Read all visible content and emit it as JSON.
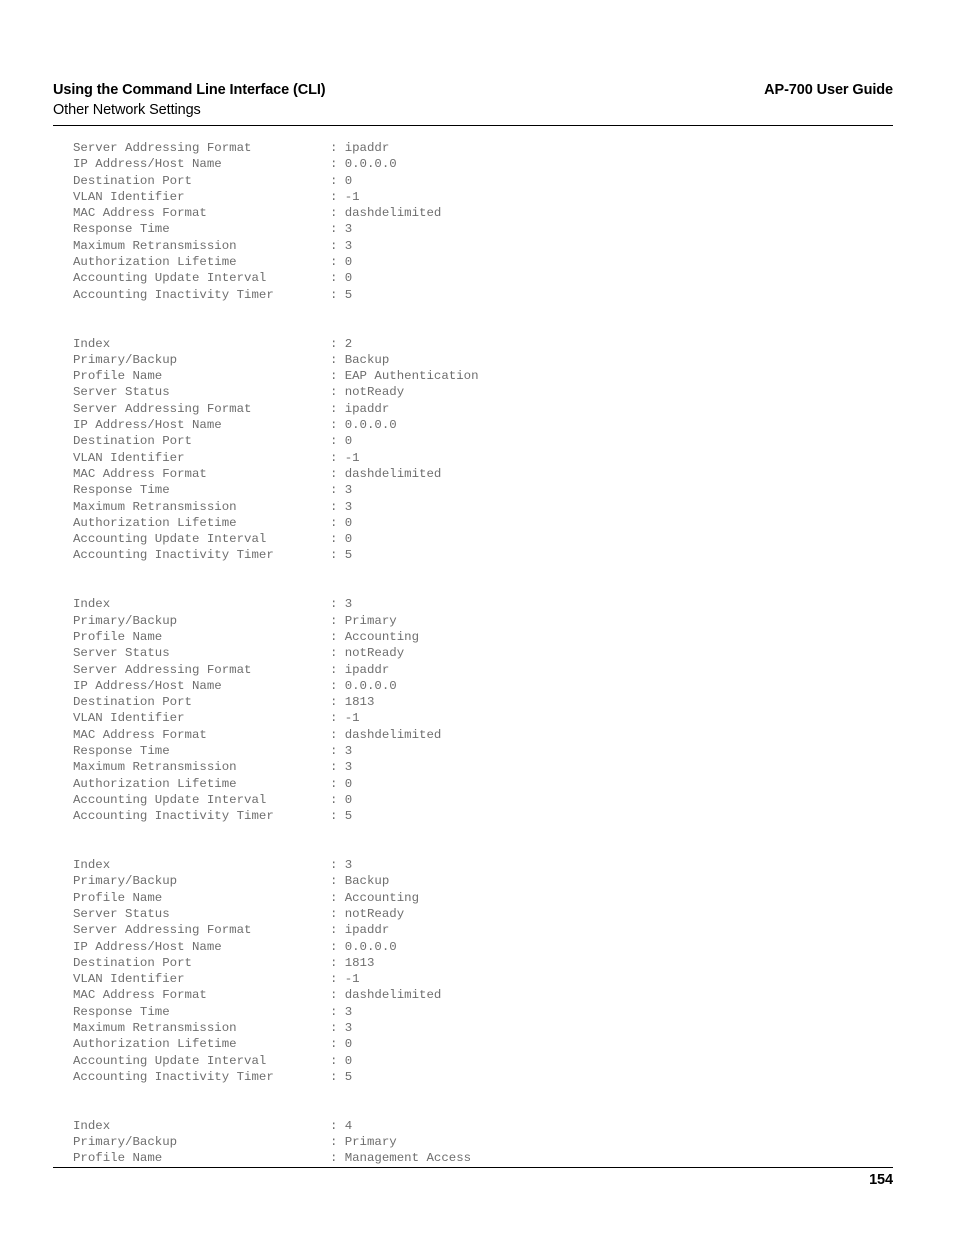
{
  "document": {
    "header": {
      "section_title": "Using the Command Line Interface (CLI)",
      "guide_title": "AP-700 User Guide",
      "subsection_title": "Other Network Settings"
    },
    "footer": {
      "page_number": "154"
    }
  },
  "cli_output": {
    "separator": ":",
    "blocks": [
      {
        "id": "radius-server-record-continued",
        "rows": [
          {
            "label": "Server Addressing Format",
            "value": "ipaddr"
          },
          {
            "label": "IP Address/Host Name",
            "value": "0.0.0.0"
          },
          {
            "label": "Destination Port",
            "value": "0"
          },
          {
            "label": "VLAN Identifier",
            "value": "-1"
          },
          {
            "label": "MAC Address Format",
            "value": "dashdelimited"
          },
          {
            "label": "Response Time",
            "value": "3"
          },
          {
            "label": "Maximum Retransmission",
            "value": "3"
          },
          {
            "label": "Authorization Lifetime",
            "value": "0"
          },
          {
            "label": "Accounting Update Interval",
            "value": "0"
          },
          {
            "label": "Accounting Inactivity Timer",
            "value": "5"
          }
        ]
      },
      {
        "id": "radius-server-record-index-2",
        "rows": [
          {
            "label": "Index",
            "value": "2"
          },
          {
            "label": "Primary/Backup",
            "value": "Backup"
          },
          {
            "label": "Profile Name",
            "value": "EAP Authentication"
          },
          {
            "label": "Server Status",
            "value": "notReady"
          },
          {
            "label": "Server Addressing Format",
            "value": "ipaddr"
          },
          {
            "label": "IP Address/Host Name",
            "value": "0.0.0.0"
          },
          {
            "label": "Destination Port",
            "value": "0"
          },
          {
            "label": "VLAN Identifier",
            "value": "-1"
          },
          {
            "label": "MAC Address Format",
            "value": "dashdelimited"
          },
          {
            "label": "Response Time",
            "value": "3"
          },
          {
            "label": "Maximum Retransmission",
            "value": "3"
          },
          {
            "label": "Authorization Lifetime",
            "value": "0"
          },
          {
            "label": "Accounting Update Interval",
            "value": "0"
          },
          {
            "label": "Accounting Inactivity Timer",
            "value": "5"
          }
        ]
      },
      {
        "id": "radius-server-record-index-3-primary",
        "rows": [
          {
            "label": "Index",
            "value": "3"
          },
          {
            "label": "Primary/Backup",
            "value": "Primary"
          },
          {
            "label": "Profile Name",
            "value": "Accounting"
          },
          {
            "label": "Server Status",
            "value": "notReady"
          },
          {
            "label": "Server Addressing Format",
            "value": "ipaddr"
          },
          {
            "label": "IP Address/Host Name",
            "value": "0.0.0.0"
          },
          {
            "label": "Destination Port",
            "value": "1813"
          },
          {
            "label": "VLAN Identifier",
            "value": "-1"
          },
          {
            "label": "MAC Address Format",
            "value": "dashdelimited"
          },
          {
            "label": "Response Time",
            "value": "3"
          },
          {
            "label": "Maximum Retransmission",
            "value": "3"
          },
          {
            "label": "Authorization Lifetime",
            "value": "0"
          },
          {
            "label": "Accounting Update Interval",
            "value": "0"
          },
          {
            "label": "Accounting Inactivity Timer",
            "value": "5"
          }
        ]
      },
      {
        "id": "radius-server-record-index-3-backup",
        "rows": [
          {
            "label": "Index",
            "value": "3"
          },
          {
            "label": "Primary/Backup",
            "value": "Backup"
          },
          {
            "label": "Profile Name",
            "value": "Accounting"
          },
          {
            "label": "Server Status",
            "value": "notReady"
          },
          {
            "label": "Server Addressing Format",
            "value": "ipaddr"
          },
          {
            "label": "IP Address/Host Name",
            "value": "0.0.0.0"
          },
          {
            "label": "Destination Port",
            "value": "1813"
          },
          {
            "label": "VLAN Identifier",
            "value": "-1"
          },
          {
            "label": "MAC Address Format",
            "value": "dashdelimited"
          },
          {
            "label": "Response Time",
            "value": "3"
          },
          {
            "label": "Maximum Retransmission",
            "value": "3"
          },
          {
            "label": "Authorization Lifetime",
            "value": "0"
          },
          {
            "label": "Accounting Update Interval",
            "value": "0"
          },
          {
            "label": "Accounting Inactivity Timer",
            "value": "5"
          }
        ]
      },
      {
        "id": "radius-server-record-index-4-truncated",
        "rows": [
          {
            "label": "Index",
            "value": "4"
          },
          {
            "label": "Primary/Backup",
            "value": "Primary"
          },
          {
            "label": "Profile Name",
            "value": "Management Access"
          }
        ]
      }
    ]
  }
}
